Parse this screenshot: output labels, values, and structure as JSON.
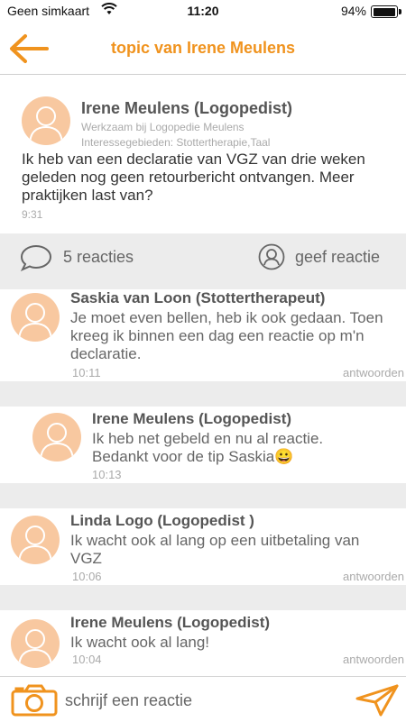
{
  "status_bar": {
    "carrier": "Geen simkaart",
    "time": "11:20",
    "battery": "94%"
  },
  "header": {
    "title": "topic van Irene Meulens",
    "back_icon": "back-arrow-icon"
  },
  "post": {
    "author": "Irene Meulens (Logopedist)",
    "workplace": "Werkzaam bij Logopedie Meulens",
    "interests": "Interessegebieden: Stottertherapie,Taal",
    "body": "Ik heb van een declaratie van VGZ van drie weken geleden nog geen retourbericht ontvangen. Meer praktijken last van?",
    "time": "9:31"
  },
  "actions": {
    "comments_label": "5 reacties",
    "reply_label": "geef reactie"
  },
  "replies": [
    {
      "name": "Saskia van Loon (Stottertherapeut)",
      "text": "Je moet even bellen, heb ik ook gedaan. Toen kreeg ik binnen een dag een reactie op m'n declaratie.",
      "time": "10:11",
      "answer": "antwoorden"
    },
    {
      "name": "Irene Meulens (Logopedist)",
      "text": "Ik heb net gebeld en nu al reactie. Bedankt voor de tip Saskia😀",
      "time": "10:13"
    },
    {
      "name": "Linda Logo (Logopedist )",
      "text": "Ik wacht ook al lang op een uitbetaling van VGZ",
      "time": "10:06",
      "answer": "antwoorden"
    },
    {
      "name": "Irene Meulens (Logopedist)",
      "text": "Ik wacht ook al lang!",
      "time": "10:04",
      "answer": "antwoorden"
    }
  ],
  "composer": {
    "placeholder": "schrijf een reactie"
  },
  "colors": {
    "accent": "#f0931e",
    "avatar_bg": "#f8c8a0",
    "divider": "#ececec"
  }
}
